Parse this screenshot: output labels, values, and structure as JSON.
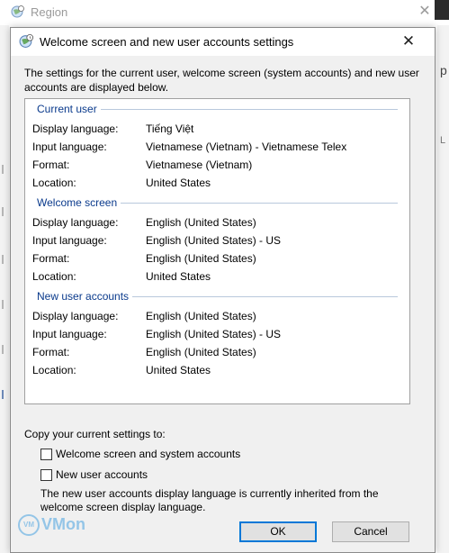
{
  "parent_window": {
    "title": "Region",
    "close_glyph": "✕",
    "right_glyph": "p",
    "right_glyph2": "L"
  },
  "dialog": {
    "title": "Welcome screen and new user accounts settings",
    "close_glyph": "✕",
    "intro": "The settings for the current user, welcome screen (system accounts) and new user accounts are displayed below.",
    "groups": [
      {
        "heading": "Current user",
        "rows": [
          {
            "key": "Display language:",
            "value": "Tiếng Việt"
          },
          {
            "key": "Input language:",
            "value": "Vietnamese (Vietnam) - Vietnamese Telex"
          },
          {
            "key": "Format:",
            "value": "Vietnamese (Vietnam)"
          },
          {
            "key": "Location:",
            "value": "United States"
          }
        ]
      },
      {
        "heading": "Welcome screen",
        "rows": [
          {
            "key": "Display language:",
            "value": "English (United States)"
          },
          {
            "key": "Input language:",
            "value": "English (United States) - US"
          },
          {
            "key": "Format:",
            "value": "English (United States)"
          },
          {
            "key": "Location:",
            "value": "United States"
          }
        ]
      },
      {
        "heading": "New user accounts",
        "rows": [
          {
            "key": "Display language:",
            "value": "English (United States)"
          },
          {
            "key": "Input language:",
            "value": "English (United States) - US"
          },
          {
            "key": "Format:",
            "value": "English (United States)"
          },
          {
            "key": "Location:",
            "value": "United States"
          }
        ]
      }
    ],
    "copy_label": "Copy your current settings to:",
    "checkboxes": [
      {
        "label": "Welcome screen and system accounts",
        "checked": false
      },
      {
        "label": "New user accounts",
        "checked": false
      }
    ],
    "note": "The new user accounts display language is currently inherited from the welcome screen display language.",
    "ok_label": "OK",
    "cancel_label": "Cancel"
  },
  "watermark": {
    "badge": "VM",
    "text": "VMon"
  },
  "colors": {
    "group_heading": "#0a3a8c",
    "focus_border": "#0078d7",
    "dialog_bg": "#f0f0f0"
  },
  "icons": {
    "window_icon": "globe-clock-icon",
    "close": "close-icon"
  }
}
